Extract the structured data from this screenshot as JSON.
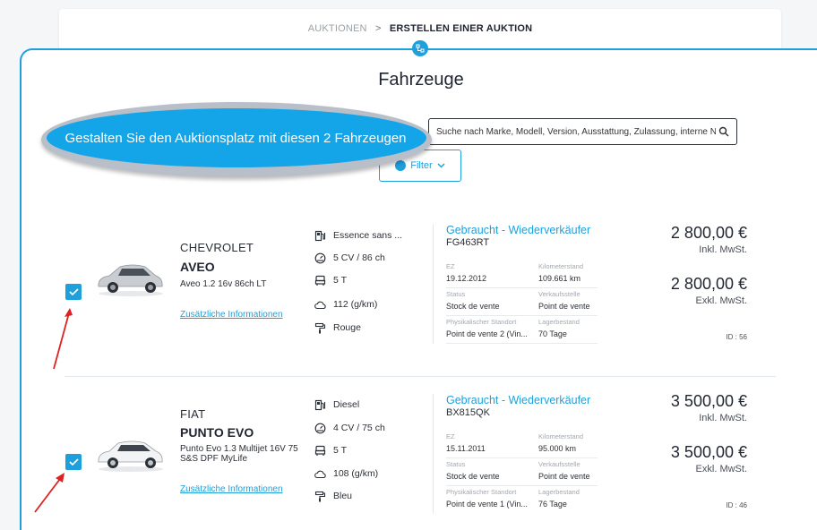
{
  "breadcrumb": {
    "parent": "AUKTIONEN",
    "separator": ">",
    "current": "ERSTELLEN EINER AUKTION"
  },
  "page": {
    "title": "Fahrzeuge"
  },
  "callout": {
    "text": "Gestalten Sie den Auktionsplatz mit diesen 2 Fahrzeugen"
  },
  "search": {
    "placeholder": "Suche nach Marke, Modell, Version, Ausstattung, Zulassung, interne Nummer oder Fah..."
  },
  "filter": {
    "label": "Filter"
  },
  "vehicles": [
    {
      "selected": true,
      "brand": "CHEVROLET",
      "model": "AVEO",
      "version": "Aveo 1.2 16v 86ch LT",
      "more_link": "Zusätzliche Informationen",
      "fuel": "Essence sans ...",
      "power": "5 CV / 86 ch",
      "seats": "5 T",
      "co2": "112 (g/km)",
      "color": "Rouge",
      "condition": "Gebraucht - Wiederverkäufer",
      "plate": "FG463RT",
      "ez_label": "EZ",
      "ez": "19.12.2012",
      "km_label": "Kilometerstand",
      "km": "109.661 km",
      "status_label": "Status",
      "status": "Stock de vente",
      "sale_point_label": "Verkaufsstelle",
      "sale_point": "Point de vente",
      "location_label": "Physikalischer Standort",
      "location": "Point de vente 2 (Vin...",
      "stock_label": "Lagerbestand",
      "stock": "70 Tage",
      "price_incl": "2 800,00 €",
      "incl_label": "Inkl. MwSt.",
      "price_excl": "2 800,00 €",
      "excl_label": "Exkl. MwSt.",
      "id": "ID : 56",
      "car_color": "#c9cdd2"
    },
    {
      "selected": true,
      "brand": "FIAT",
      "model": "PUNTO EVO",
      "version": "Punto Evo 1.3 Multijet 16V 75 S&S DPF MyLife",
      "more_link": "Zusätzliche Informationen",
      "fuel": "Diesel",
      "power": "4 CV / 75 ch",
      "seats": "5 T",
      "co2": "108 (g/km)",
      "color": "Bleu",
      "condition": "Gebraucht - Wiederverkäufer",
      "plate": "BX815QK",
      "ez_label": "EZ",
      "ez": "15.11.2011",
      "km_label": "Kilometerstand",
      "km": "95.000 km",
      "status_label": "Status",
      "status": "Stock de vente",
      "sale_point_label": "Verkaufsstelle",
      "sale_point": "Point de vente",
      "location_label": "Physikalischer Standort",
      "location": "Point de vente 1 (Vin...",
      "stock_label": "Lagerbestand",
      "stock": "76 Tage",
      "price_incl": "3 500,00 €",
      "incl_label": "Inkl. MwSt.",
      "price_excl": "3 500,00 €",
      "excl_label": "Exkl. MwSt.",
      "id": "ID : 46",
      "car_color": "#f2f3f4"
    }
  ],
  "colors": {
    "accent": "#1ea0dc",
    "callout": "#14a4e8",
    "arrow": "#e02020"
  }
}
